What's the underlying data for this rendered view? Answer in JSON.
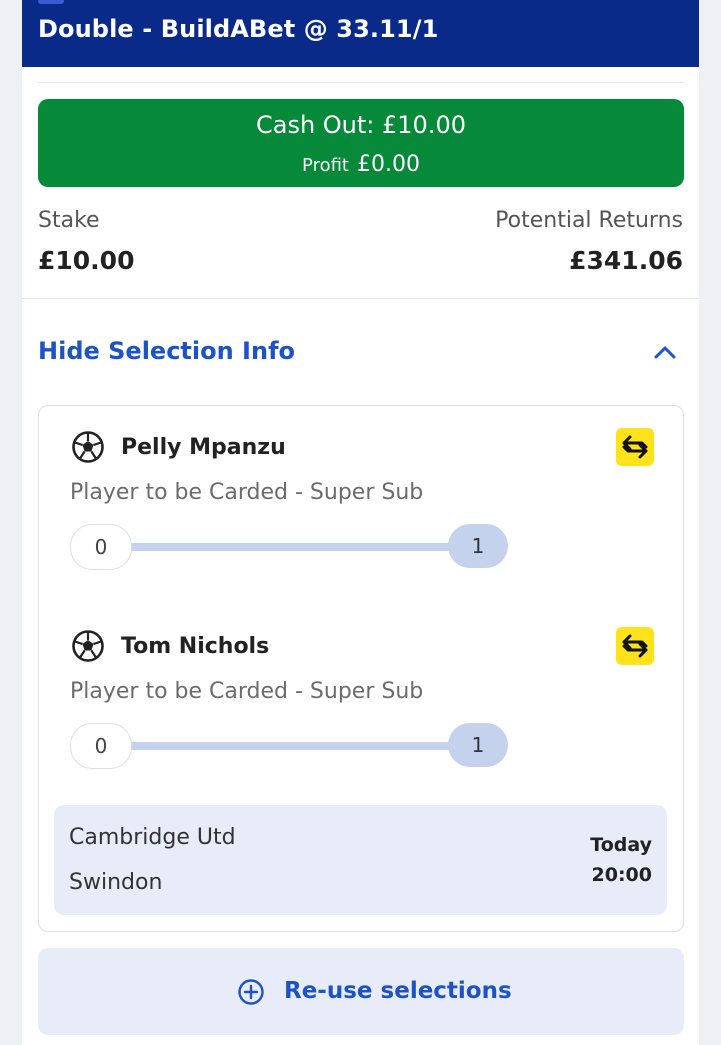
{
  "header": {
    "title": "Double - BuildABet @ 33.11/1"
  },
  "cashout": {
    "title": "Cash Out: £10.00",
    "profit_label": "Profit",
    "profit_value": "£0.00"
  },
  "summary": {
    "stake_label": "Stake",
    "stake_value": "£10.00",
    "returns_label": "Potential Returns",
    "returns_value": "£341.06"
  },
  "selection_toggle": {
    "label": "Hide Selection Info"
  },
  "selections": [
    {
      "name": "Pelly Mpanzu",
      "market": "Player to be Carded - Super Sub",
      "min": "0",
      "max": "1"
    },
    {
      "name": "Tom Nichols",
      "market": "Player to be Carded - Super Sub",
      "min": "0",
      "max": "1"
    }
  ],
  "event": {
    "home": "Cambridge Utd",
    "away": "Swindon",
    "day": "Today",
    "time": "20:00"
  },
  "reuse": {
    "label": "Re-use selections"
  },
  "icons": {
    "ball": "football-icon",
    "swap": "swap-icon",
    "chevron": "chevron-up-icon",
    "plus": "plus-circle-icon"
  },
  "colors": {
    "header": "#0a2a8a",
    "cashout": "#068a3a",
    "link": "#1d53c8",
    "swap_bg": "#ffe21a"
  }
}
